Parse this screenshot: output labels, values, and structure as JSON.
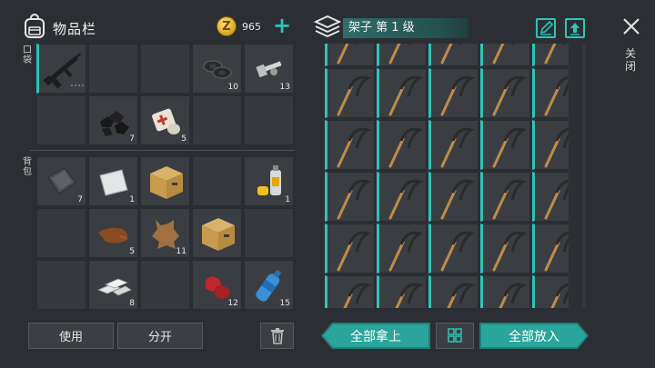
{
  "header": {
    "inventory_title": "物品栏",
    "coin_symbol": "Z",
    "coin_count": "965",
    "add_coin_label": "+"
  },
  "inventory": {
    "pocket_label": "口袋",
    "backpack_label": "背包",
    "pocket_slots": [
      {
        "item": "assault-rifle",
        "qty": ""
      },
      {
        "item": "",
        "qty": ""
      },
      {
        "item": "",
        "qty": ""
      },
      {
        "item": "washers",
        "qty": "10"
      },
      {
        "item": "bolts",
        "qty": "13"
      },
      {
        "item": "",
        "qty": ""
      },
      {
        "item": "coal",
        "qty": "7"
      },
      {
        "item": "bandage-kit",
        "qty": "5"
      },
      {
        "item": "",
        "qty": ""
      },
      {
        "item": "",
        "qty": ""
      }
    ],
    "backpack_slots": [
      {
        "item": "iron-plate",
        "qty": "7"
      },
      {
        "item": "aluminum-plate",
        "qty": "1"
      },
      {
        "item": "cardboard-box",
        "qty": ""
      },
      {
        "item": "",
        "qty": ""
      },
      {
        "item": "spray-can",
        "qty": "1"
      },
      {
        "item": "",
        "qty": ""
      },
      {
        "item": "leather",
        "qty": "5"
      },
      {
        "item": "animal-hide",
        "qty": "11"
      },
      {
        "item": "cardboard-box",
        "qty": ""
      },
      {
        "item": "",
        "qty": ""
      },
      {
        "item": "",
        "qty": ""
      },
      {
        "item": "aluminum-ingot",
        "qty": "8"
      },
      {
        "item": "",
        "qty": ""
      },
      {
        "item": "raw-meat",
        "qty": "12"
      },
      {
        "item": "water-bottle",
        "qty": "15"
      }
    ],
    "use_button": "使用",
    "split_button": "分开",
    "trash_icon": "trash-icon"
  },
  "shelf": {
    "title": "架子 第 1 级",
    "item_icon": "sickle-icon",
    "edit_icon": "edit-icon",
    "upload_icon": "upload-icon",
    "take_all_button": "全部拿上",
    "sort_icon": "grid-sort-icon",
    "put_all_button": "全部放入"
  },
  "close": {
    "icon": "close-icon",
    "label": "关闭"
  },
  "colors": {
    "accent": "#2ec4b6",
    "button_teal": "#2aa59b",
    "background": "#2b2f33",
    "slot": "#363a3e"
  }
}
